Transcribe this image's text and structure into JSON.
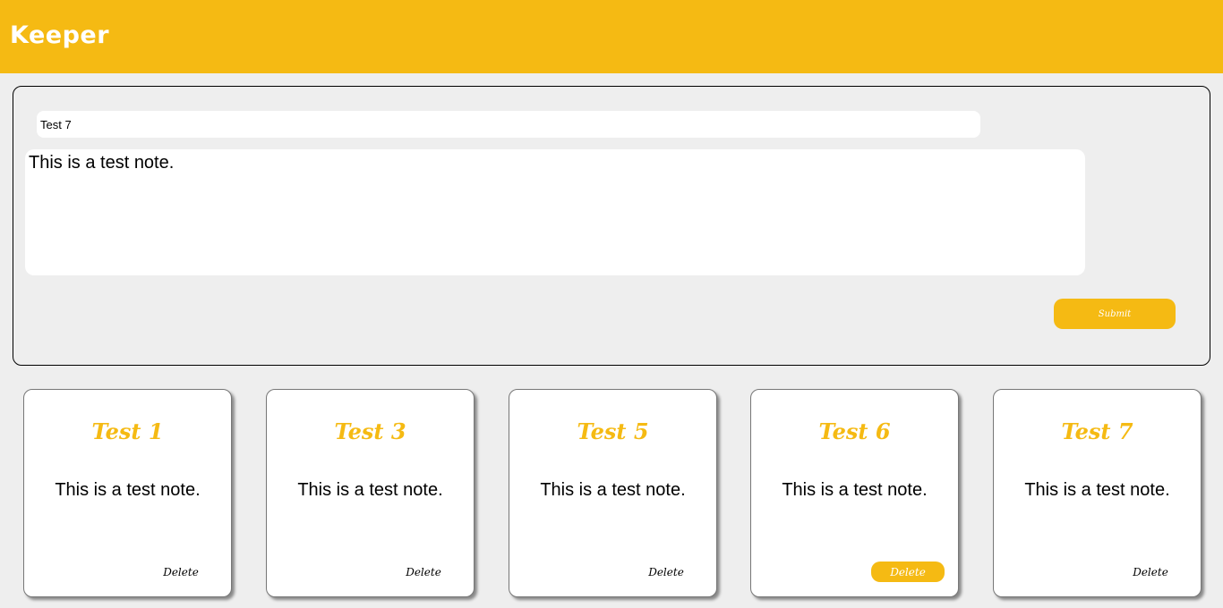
{
  "app": {
    "brand": "Keeper"
  },
  "colors": {
    "accent": "#f5ba13",
    "background": "#eeeeee",
    "card": "#ffffff"
  },
  "form": {
    "title_value": "Test 7",
    "content_value": "This is a test note.",
    "submit_label": "Submit"
  },
  "notes": [
    {
      "title": "Test 1",
      "content": "This is a test note.",
      "delete_label": "Delete"
    },
    {
      "title": "Test 3",
      "content": "This is a test note.",
      "delete_label": "Delete"
    },
    {
      "title": "Test 5",
      "content": "This is a test note.",
      "delete_label": "Delete"
    },
    {
      "title": "Test 6",
      "content": "This is a test note.",
      "delete_label": "Delete"
    },
    {
      "title": "Test 7",
      "content": "This is a test note.",
      "delete_label": "Delete"
    }
  ]
}
